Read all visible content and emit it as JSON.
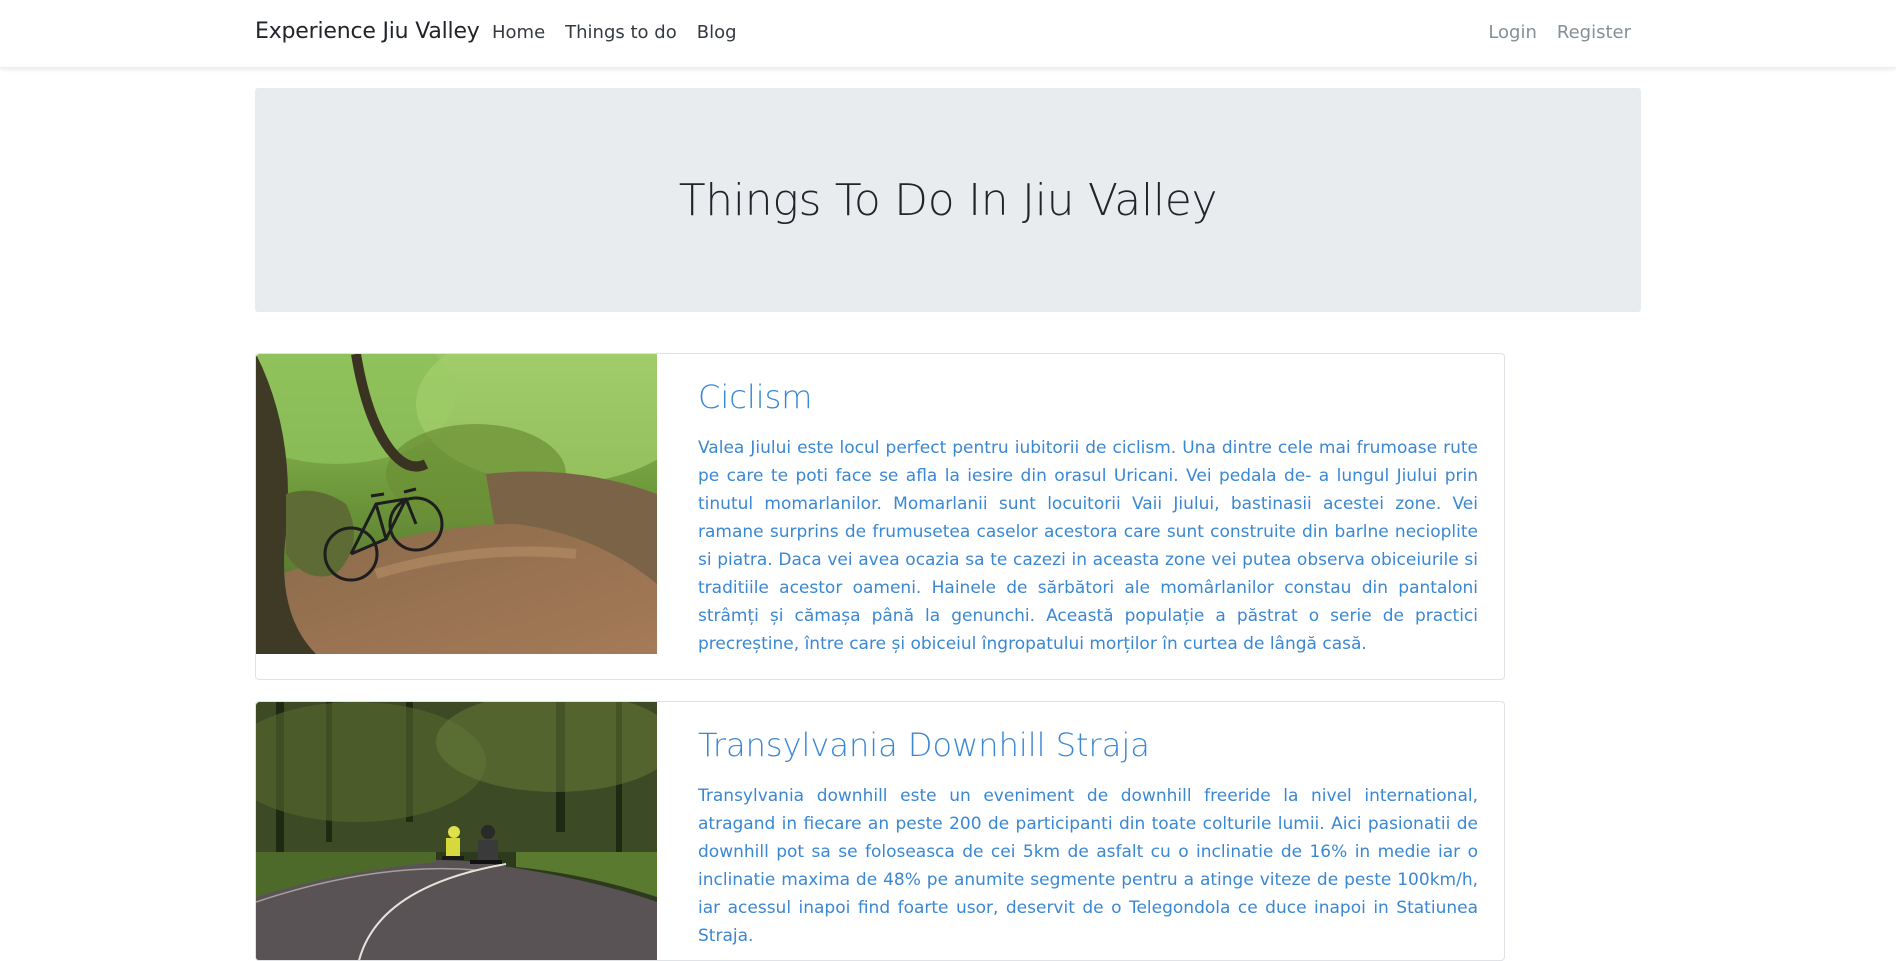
{
  "navbar": {
    "brand": "Experience Jiu Valley",
    "links": [
      "Home",
      "Things to do",
      "Blog"
    ],
    "auth": [
      "Login",
      "Register"
    ]
  },
  "hero": {
    "title": "Things To Do In Jiu Valley"
  },
  "activities": [
    {
      "title": "Ciclism",
      "image_icon": "bicycle-forest-photo",
      "description": "Valea Jiului este locul perfect pentru iubitorii de ciclism. Una dintre cele mai frumoase rute pe care te poti face se afla la iesire din orasul Uricani. Vei pedala de- a lungul Jiului prin tinutul momarlanilor. Momarlanii sunt locuitorii Vaii Jiului, bastinasii acestei zone. Vei ramane surprins de frumusetea caselor acestora care sunt construite din barlne necioplite si piatra. Daca vei avea ocazia sa te cazezi in aceasta zone vei putea observa obiceiurile si traditiile acestor oameni. Hainele de sărbători ale momârlanilor constau din pantaloni strâmți și cămașa până la genunchi. Această populație a păstrat o serie de practici precreștine, între care și obiceiul îngropatului morților în curtea de lângă casă."
    },
    {
      "title": "Transylvania Downhill Straja",
      "image_icon": "downhill-longboard-photo",
      "description": "Transylvania downhill este un eveniment de downhill freeride la nivel international, atragand in fiecare an peste 200 de participanti din toate colturile lumii. Aici pasionatii de downhill pot sa se foloseasca de cei 5km de asfalt cu o inclinatie de 16% in medie iar o inclinatie maxima de 48% pe anumite segmente pentru a atinge viteze de peste 100km/h, iar acessul inapoi find foarte usor, deservit de o Telegondola ce duce inapoi in Statiunea Straja."
    }
  ]
}
